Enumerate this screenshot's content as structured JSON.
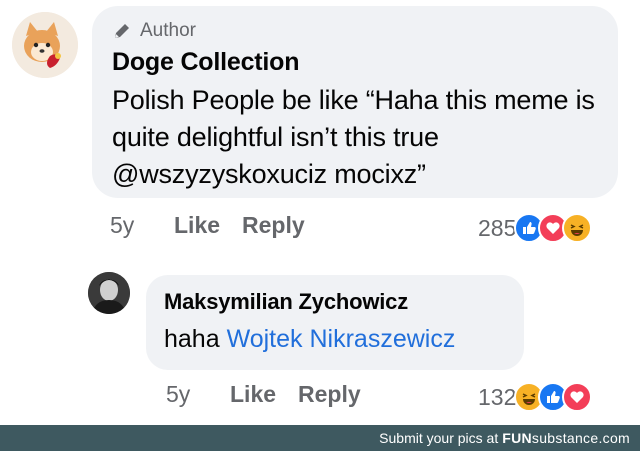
{
  "comment": {
    "author_badge": "Author",
    "name": "Doge Collection",
    "text": "Polish People be like “Haha this meme is quite delightful isn’t this true @wszyzyskoxuciz mocixz”",
    "time": "5y",
    "like_label": "Like",
    "reply_label": "Reply",
    "reaction_count": "285",
    "reactions": [
      "like",
      "love",
      "haha"
    ]
  },
  "reply": {
    "name": "Maksymilian Zychowicz",
    "text_prefix": "haha",
    "mention": "Wojtek Nikraszewicz",
    "time": "5y",
    "like_label": "Like",
    "reply_label": "Reply",
    "reaction_count": "132",
    "reactions": [
      "haha",
      "like",
      "love"
    ]
  },
  "footer": {
    "text": "Submit your pics at",
    "brand_bold": "FUN",
    "brand_light": "substance",
    "brand_tld": ".com"
  },
  "colors": {
    "bubble": "#f0f2f5",
    "mention": "#216fdb",
    "like": "#1877f2",
    "love": "#f33e58",
    "haha": "#f7b125",
    "footer": "#3e5960"
  }
}
